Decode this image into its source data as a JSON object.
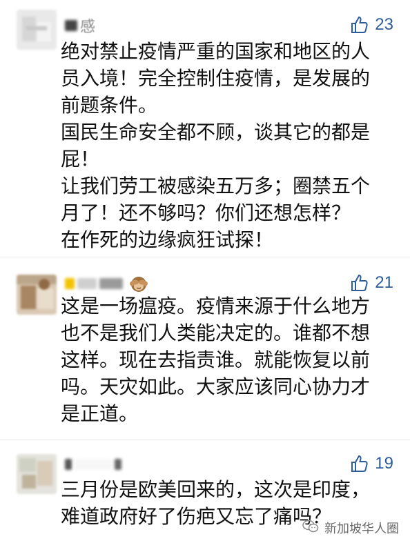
{
  "comments": [
    {
      "nickname_visible": "感",
      "likes": "23",
      "lines": [
        "绝对禁止疫情严重的国家和地区的人",
        "员入境！完全控制住疫情，是发展的",
        "前题条件。",
        "国民生命安全都不顾，谈其它的都是",
        "屁！",
        "让我们劳工被感染五万多；圈禁五个",
        "月了！还不够吗？你们还想怎样？",
        "在作死的边缘疯狂试探！"
      ]
    },
    {
      "nickname_visible": "",
      "nickname_emoji": "see-no-evil-monkey",
      "likes": "21",
      "lines": [
        "这是一场瘟疫。疫情来源于什么地方",
        "也不是我们人类能决定的。谁都不想",
        "这样。现在去指责谁。就能恢复以前",
        "吗。天灾如此。大家应该同心协力才",
        "是正道。"
      ]
    },
    {
      "nickname_visible": "",
      "likes": "19",
      "lines": [
        "三月份是欧美回来的，这次是印度，",
        "难道政府好了伤疤又忘了痛吗？"
      ]
    }
  ],
  "watermark": {
    "text": "新加坡华人圈",
    "icon": "wechat-icon"
  },
  "colors": {
    "like": "#2f5d9a",
    "text": "#111111",
    "divider": "#ececec"
  }
}
